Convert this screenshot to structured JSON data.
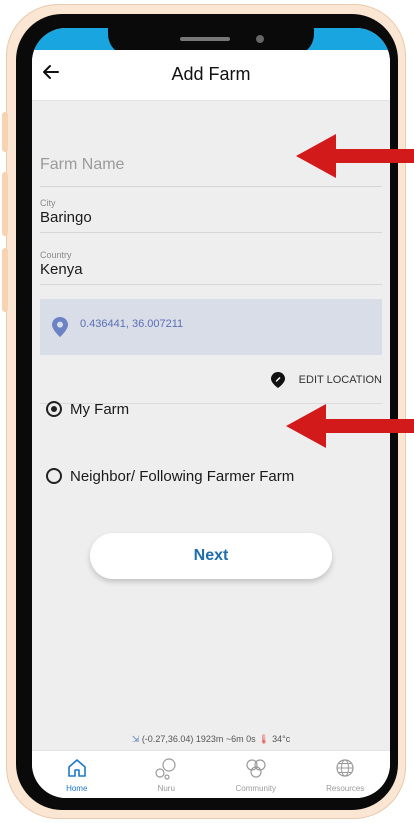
{
  "app": {
    "title": "Add Farm"
  },
  "form": {
    "farm_name_placeholder": "Farm Name",
    "city_label": "City",
    "city_value": "Baringo",
    "country_label": "Country",
    "country_value": "Kenya",
    "coordinates": "0.436441, 36.007211",
    "edit_location": "EDIT LOCATION",
    "radio_options": [
      {
        "label": "My Farm",
        "selected": true
      },
      {
        "label": "Neighbor/ Following Farmer Farm",
        "selected": false
      }
    ],
    "next_label": "Next"
  },
  "status_line": {
    "info": "(-0.27,36.04) 1923m ~6m 0s",
    "temperature": "34°c"
  },
  "nav": {
    "items": [
      {
        "label": "Home",
        "icon": "home-icon",
        "active": true
      },
      {
        "label": "Nuru",
        "icon": "bubbles-icon",
        "active": false
      },
      {
        "label": "Community",
        "icon": "community-icon",
        "active": false
      },
      {
        "label": "Resources",
        "icon": "globe-icon",
        "active": false
      }
    ]
  },
  "colors": {
    "status_bar": "#19a6e0",
    "accent_blue": "#1e78c8",
    "location_box": "#d9dde8",
    "arrow_red": "#d31a1a"
  }
}
